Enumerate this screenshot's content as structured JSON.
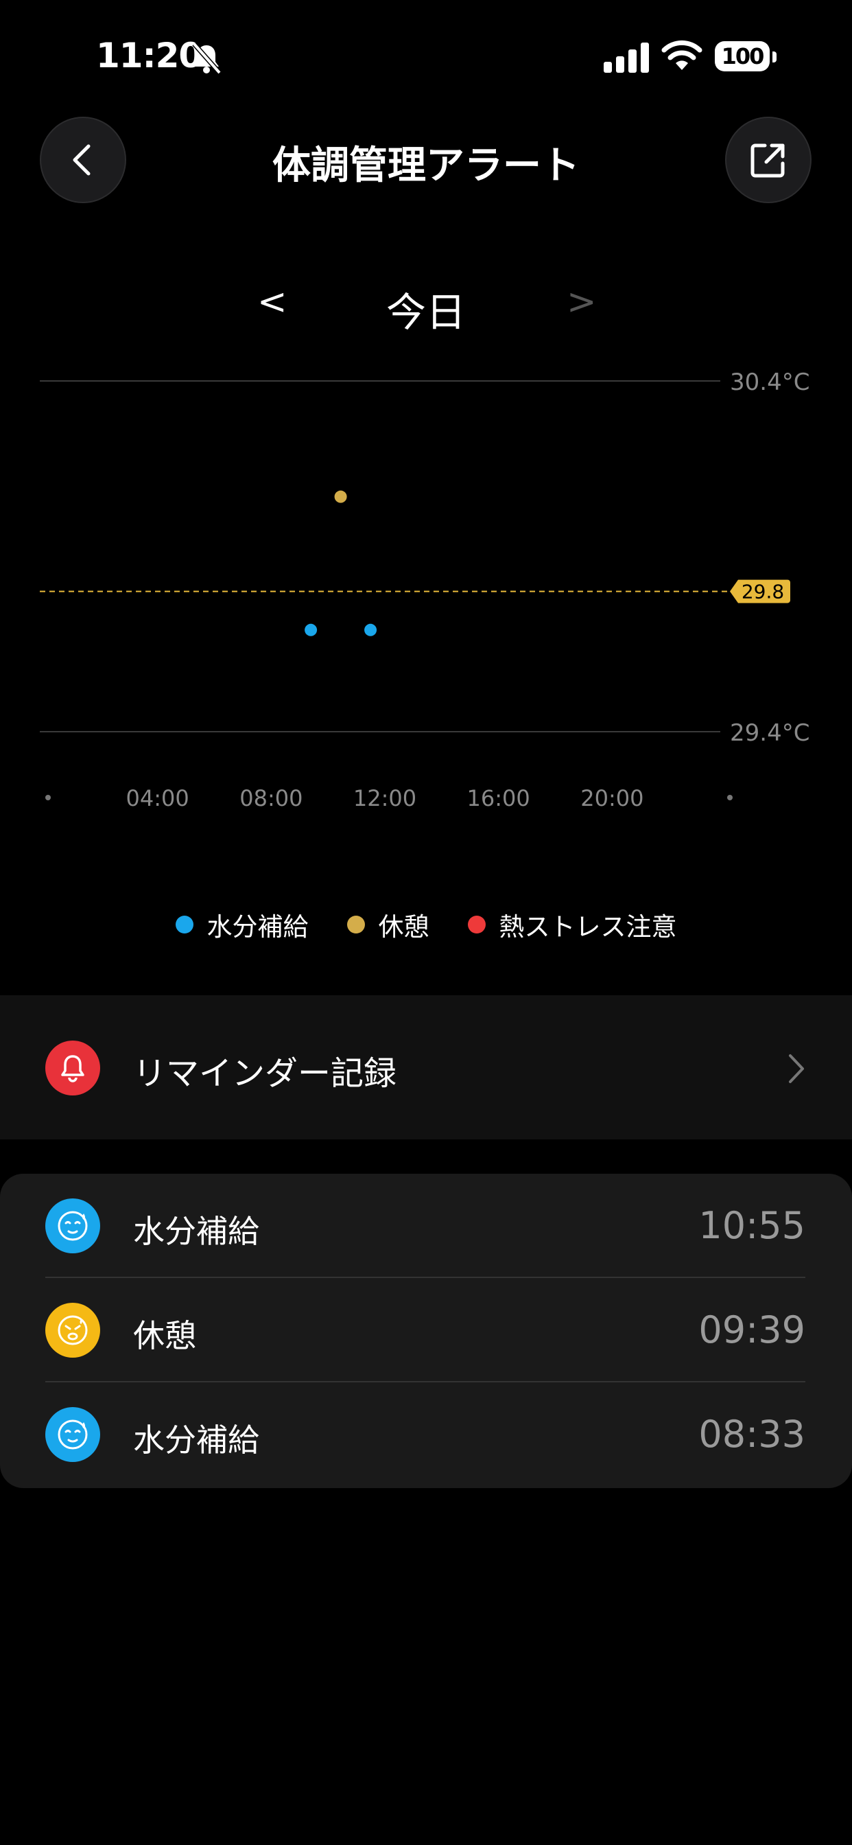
{
  "status_bar": {
    "time": "11:20",
    "battery_level": "100",
    "icons": [
      "bell-muted-icon",
      "signal-icon",
      "wifi-icon",
      "battery-icon"
    ]
  },
  "header": {
    "title": "体調管理アラート",
    "back_icon": "chevron-left-icon",
    "share_icon": "share-icon"
  },
  "date_nav": {
    "prev": "<",
    "label": "今日",
    "next": ">"
  },
  "chart_data": {
    "type": "scatter",
    "y_max_label": "30.4°C",
    "y_min_label": "29.4°C",
    "ylim": [
      29.4,
      30.4
    ],
    "xlim": [
      0,
      24
    ],
    "x_ticks": [
      "04:00",
      "08:00",
      "12:00",
      "16:00",
      "20:00"
    ],
    "threshold": {
      "value": 29.8,
      "label": "29.8",
      "color": "#e8b93b"
    },
    "series": [
      {
        "name": "水分補給",
        "color": "#1aa7ec",
        "points": [
          {
            "x": 9.25,
            "y": 29.69
          },
          {
            "x": 11.35,
            "y": 29.69
          }
        ]
      },
      {
        "name": "休憩",
        "color": "#d4ad4a",
        "points": [
          {
            "x": 10.3,
            "y": 30.07
          }
        ]
      },
      {
        "name": "熱ストレス注意",
        "color": "#ee3a3a",
        "points": []
      }
    ],
    "grid": "top-bottom-lines",
    "legend_position": "bottom-center"
  },
  "legend": [
    {
      "label": "水分補給",
      "color": "#1aa7ec"
    },
    {
      "label": "休憩",
      "color": "#d4ad4a"
    },
    {
      "label": "熱ストレス注意",
      "color": "#ee3a3a"
    }
  ],
  "reminder": {
    "label": "リマインダー記録",
    "icon": "bell-icon",
    "chevron": "chevron-right-icon",
    "color": "#e8323a"
  },
  "records": [
    {
      "label": "水分補給",
      "time": "10:55",
      "icon": "hydration-icon",
      "color": "#1aa7ec"
    },
    {
      "label": "休憩",
      "time": "09:39",
      "icon": "rest-icon",
      "color": "#f5b915"
    },
    {
      "label": "水分補給",
      "time": "08:33",
      "icon": "hydration-icon",
      "color": "#1aa7ec"
    }
  ]
}
